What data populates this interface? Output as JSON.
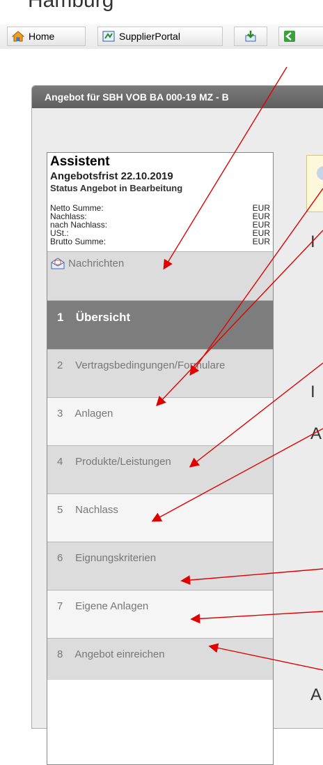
{
  "page": {
    "title_fragment": "Hamburg"
  },
  "toolbar": {
    "home_label": "Home",
    "supplier_label": "SupplierPortal"
  },
  "panel": {
    "header": "Angebot für SBH VOB BA 000-19 MZ - B"
  },
  "assistant": {
    "title": "Assistent",
    "deadline": "Angebotsfrist 22.10.2019",
    "status": "Status Angebot in Bearbeitung",
    "summary": [
      {
        "label": "Netto Summe:",
        "currency": "EUR"
      },
      {
        "label": "Nachlass:",
        "currency": "EUR"
      },
      {
        "label": "nach Nachlass:",
        "currency": "EUR"
      },
      {
        "label": "USt.:",
        "currency": "EUR"
      },
      {
        "label": "Brutto Summe:",
        "currency": "EUR"
      }
    ],
    "messages_label": "Nachrichten",
    "steps": [
      {
        "num": "1",
        "label": "Übersicht"
      },
      {
        "num": "2",
        "label": "Vertragsbedingungen/Formulare"
      },
      {
        "num": "3",
        "label": "Anlagen"
      },
      {
        "num": "4",
        "label": "Produkte/Leistungen"
      },
      {
        "num": "5",
        "label": "Nachlass"
      },
      {
        "num": "6",
        "label": "Eignungskriterien"
      },
      {
        "num": "7",
        "label": "Eigene Anlagen"
      },
      {
        "num": "8",
        "label": "Angebot einreichen"
      }
    ]
  },
  "content": {
    "frag_1": "I",
    "frag_2": "I",
    "frag_3": "A",
    "frag_4": "A"
  },
  "colors": {
    "arrow": "#e00000",
    "active_step": "#7d7d7d",
    "header": "#666666"
  }
}
